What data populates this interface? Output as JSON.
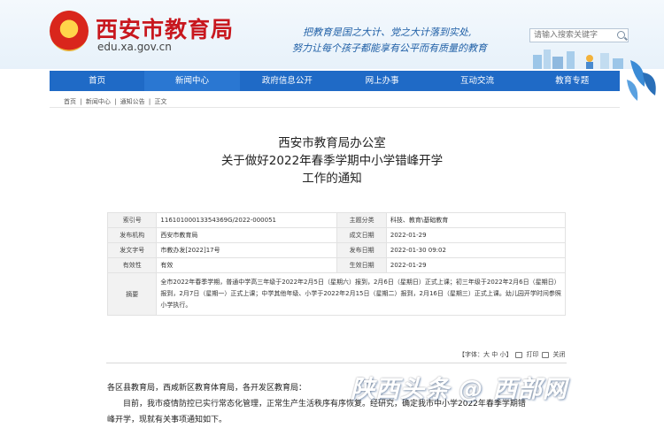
{
  "header": {
    "site_title": "西安市教育局",
    "site_url": "edu.xa.gov.cn",
    "slogan_line1": "把教育是国之大计、党之大计落到实处,",
    "slogan_line2": "努力让每个孩子都能享有公平而有质量的教育",
    "search_placeholder": "请输入搜索关键字"
  },
  "nav": {
    "items": [
      "首页",
      "新闻中心",
      "政府信息公开",
      "网上办事",
      "互动交流",
      "教育专题"
    ]
  },
  "breadcrumb": [
    "首页",
    "|",
    "新闻中心",
    "|",
    "通知公告",
    "|",
    "正文"
  ],
  "article": {
    "title_line1": "西安市教育局办公室",
    "title_line2": "关于做好2022年春季学期中小学错峰开学",
    "title_line3": "工作的通知"
  },
  "meta": {
    "rows": [
      {
        "l1": "索引号",
        "v1": "11610100013354369G/2022-000051",
        "l2": "主题分类",
        "v2": "科技、教育\\基础教育"
      },
      {
        "l1": "发布机构",
        "v1": "西安市教育局",
        "l2": "成文日期",
        "v2": "2022-01-29"
      },
      {
        "l1": "发文字号",
        "v1": "市教办发[2022]17号",
        "l2": "发布日期",
        "v2": "2022-01-30 09:02"
      },
      {
        "l1": "有效性",
        "v1": "有效",
        "l2": "生效日期",
        "v2": "2022-01-29"
      }
    ],
    "summary_label": "摘要",
    "summary_text": "全市2022年春季学期，普通中学高三年级于2022年2月5日（星期六）报到，2月6日（星期日）正式上课；初三年级于2022年2月6日（星期日）报到，2月7日（星期一）正式上课；中学其他年级、小学于2022年2月15日（星期二）报到，2月16日（星期三）正式上课。幼儿园开学时间参照小学执行。"
  },
  "toolbar": {
    "font_size": "【字体：大 中 小】",
    "print": "打印",
    "close": "关闭"
  },
  "body": {
    "salutation": "各区县教育局，西咸新区教育体育局，各开发区教育局：",
    "para1": "目前，我市疫情防控已实行常态化管理，正常生产生活秩序有序恢复。经研究，确定我市中小学2022年春季学期错",
    "para1b": "峰开学，现就有关事项通知如下。"
  },
  "watermark": "陕西头条 @ 西部网"
}
